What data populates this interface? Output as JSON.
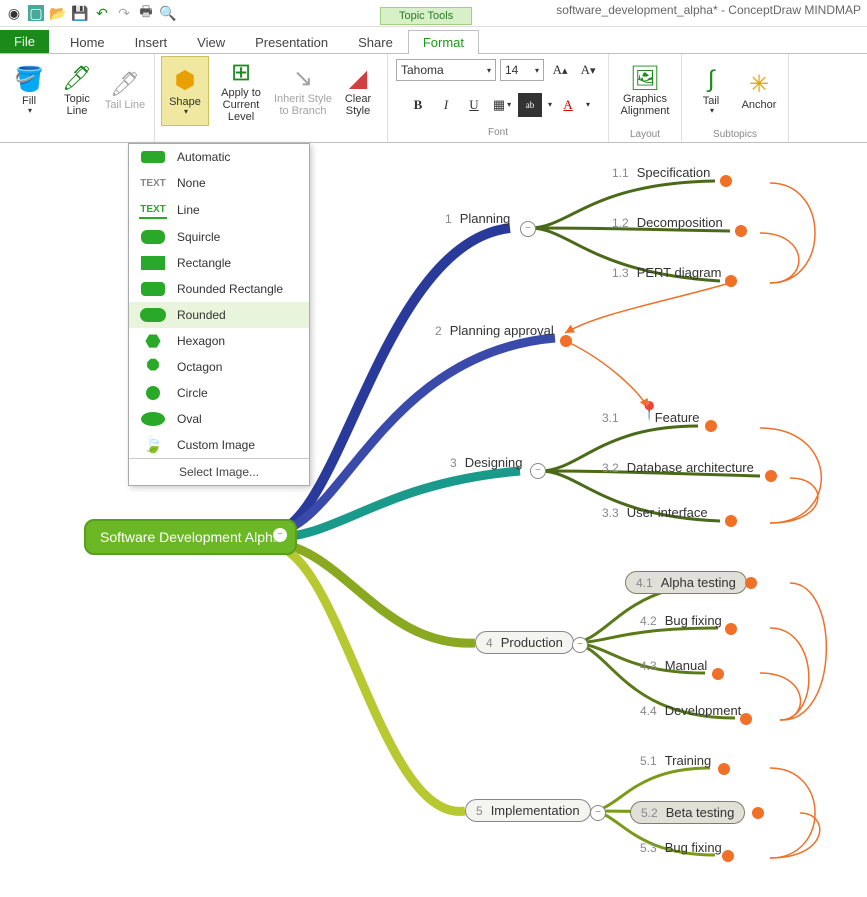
{
  "app_title": "software_development_alpha* - ConceptDraw MINDMAP",
  "qat_icons": [
    "new",
    "open",
    "save",
    "save-as",
    "undo",
    "redo",
    "print",
    "preview",
    "help"
  ],
  "file_label": "File",
  "tabs": [
    "Home",
    "Insert",
    "View",
    "Presentation",
    "Share",
    "Format"
  ],
  "active_tab": "Format",
  "contextual_label": "Topic Tools",
  "ribbon": {
    "fill": "Fill",
    "topic_line": "Topic Line",
    "tail_line": "Tail Line",
    "shape": "Shape",
    "apply": "Apply to Current Level",
    "inherit": "Inherit Style to Branch",
    "clear": "Clear Style",
    "font_name": "Tahoma",
    "font_size": "14",
    "font_group": "Font",
    "graphics": "Graphics Alignment",
    "layout_group": "Layout",
    "tail": "Tail",
    "anchor": "Anchor",
    "subtopics_group": "Subtopics"
  },
  "shape_menu": {
    "items": [
      "Automatic",
      "None",
      "Line",
      "Squircle",
      "Rectangle",
      "Rounded Rectangle",
      "Rounded",
      "Hexagon",
      "Octagon",
      "Circle",
      "Oval",
      "Custom Image"
    ],
    "selected": "Rounded",
    "footer": "Select Image..."
  },
  "map": {
    "root": "Software Development Alpha",
    "branches": [
      {
        "n": "1",
        "label": "Planning",
        "children": [
          {
            "n": "1.1",
            "label": "Specification"
          },
          {
            "n": "1.2",
            "label": "Decomposition"
          },
          {
            "n": "1.3",
            "label": "PERT diagram"
          }
        ]
      },
      {
        "n": "2",
        "label": "Planning approval",
        "children": []
      },
      {
        "n": "3",
        "label": "Designing",
        "children": [
          {
            "n": "3.1",
            "label": "Feature"
          },
          {
            "n": "3.2",
            "label": "Database architecture"
          },
          {
            "n": "3.3",
            "label": "User interface"
          }
        ]
      },
      {
        "n": "4",
        "label": "Production",
        "pill": true,
        "children": [
          {
            "n": "4.1",
            "label": "Alpha testing",
            "pill": true,
            "hl": true
          },
          {
            "n": "4.2",
            "label": "Bug fixing"
          },
          {
            "n": "4.3",
            "label": "Manual"
          },
          {
            "n": "4.4",
            "label": "Development"
          }
        ]
      },
      {
        "n": "5",
        "label": "Implementation",
        "pill": true,
        "children": [
          {
            "n": "5.1",
            "label": "Training"
          },
          {
            "n": "5.2",
            "label": "Beta testing",
            "pill": true,
            "hl": true
          },
          {
            "n": "5.3",
            "label": "Bug fixing"
          }
        ]
      }
    ]
  }
}
